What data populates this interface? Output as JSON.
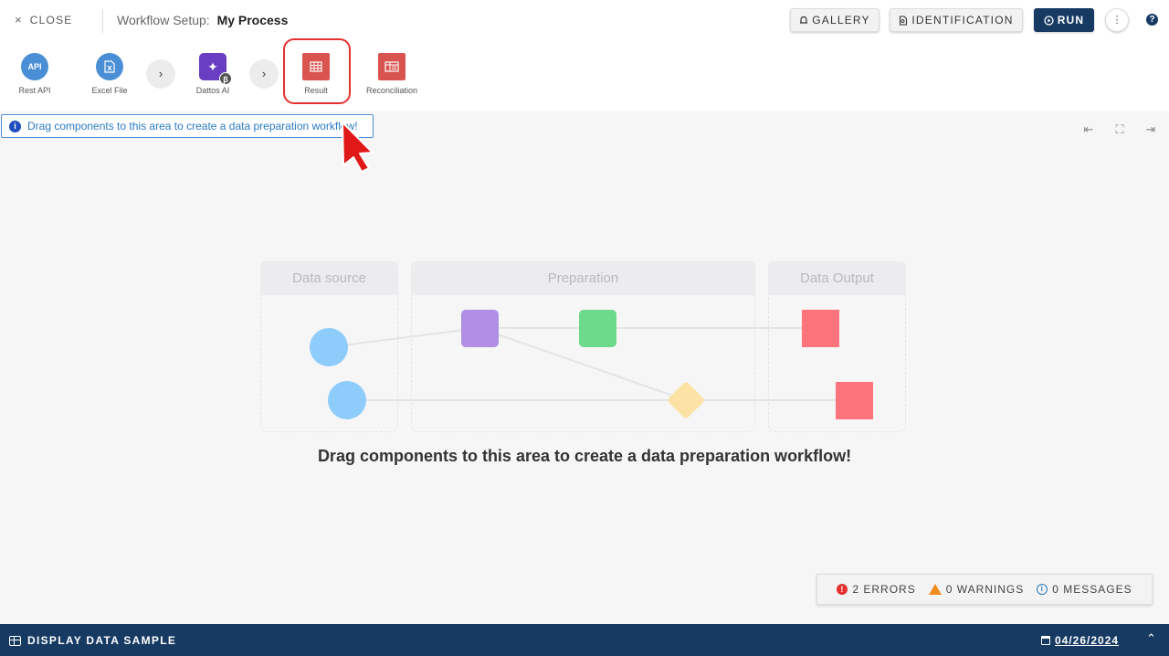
{
  "header": {
    "close_label": "CLOSE",
    "workflow_prefix": "Workflow Setup:",
    "workflow_name": "My Process",
    "gallery_label": "GALLERY",
    "identification_label": "IDENTIFICATION",
    "run_label": "RUN",
    "more_icon": "⋮",
    "help_icon": "?"
  },
  "toolbar": {
    "components": [
      {
        "label": "Rest API",
        "icon_text": "API",
        "icon": "api-icon"
      },
      {
        "label": "Excel File",
        "icon_text": "X",
        "icon": "excel-file-icon"
      },
      {
        "label": "Dattos AI",
        "icon_text": "✦",
        "icon": "sparkle-icon",
        "badge": "β"
      },
      {
        "label": "Result",
        "icon_text": "▦",
        "icon": "table-icon"
      },
      {
        "label": "Reconciliation",
        "icon_text": "▤",
        "icon": "reconciliation-icon"
      }
    ],
    "expand_icon": "›"
  },
  "info_banner": {
    "text": "Drag components to this area to create a data preparation workflow!",
    "icon_text": "i"
  },
  "canvas_controls": {
    "collapse_left": "⇤",
    "fit": "⛶",
    "collapse_right": "⇥"
  },
  "illustration": {
    "zones": [
      "Data source",
      "Preparation",
      "Data Output"
    ]
  },
  "main_message": "Drag components to this area to create a data preparation workflow!",
  "status": {
    "errors": "2 ERRORS",
    "warnings": "0 WARNINGS",
    "messages": "0 MESSAGES",
    "error_icon": "!",
    "message_icon": "i"
  },
  "footer": {
    "display_label": "DISPLAY DATA SAMPLE",
    "date": "04/26/2024",
    "expand_icon": "⌃"
  },
  "colors": {
    "brand_navy": "#173a63",
    "highlight_red": "#e53030",
    "node_blue": "#8ecdfb",
    "node_purple": "#b08ee4",
    "node_green": "#6dd98a",
    "node_red": "#fd747c",
    "node_yellow": "#fde2a6"
  }
}
